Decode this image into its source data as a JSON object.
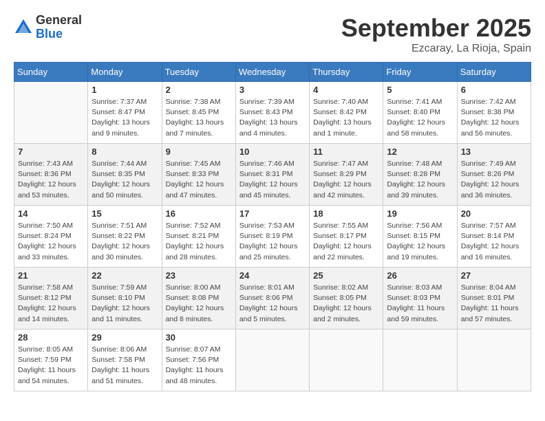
{
  "logo": {
    "general": "General",
    "blue": "Blue"
  },
  "title": "September 2025",
  "location": "Ezcaray, La Rioja, Spain",
  "days_header": [
    "Sunday",
    "Monday",
    "Tuesday",
    "Wednesday",
    "Thursday",
    "Friday",
    "Saturday"
  ],
  "weeks": [
    [
      {
        "num": "",
        "info": ""
      },
      {
        "num": "1",
        "info": "Sunrise: 7:37 AM\nSunset: 8:47 PM\nDaylight: 13 hours\nand 9 minutes."
      },
      {
        "num": "2",
        "info": "Sunrise: 7:38 AM\nSunset: 8:45 PM\nDaylight: 13 hours\nand 7 minutes."
      },
      {
        "num": "3",
        "info": "Sunrise: 7:39 AM\nSunset: 8:43 PM\nDaylight: 13 hours\nand 4 minutes."
      },
      {
        "num": "4",
        "info": "Sunrise: 7:40 AM\nSunset: 8:42 PM\nDaylight: 13 hours\nand 1 minute."
      },
      {
        "num": "5",
        "info": "Sunrise: 7:41 AM\nSunset: 8:40 PM\nDaylight: 12 hours\nand 58 minutes."
      },
      {
        "num": "6",
        "info": "Sunrise: 7:42 AM\nSunset: 8:38 PM\nDaylight: 12 hours\nand 56 minutes."
      }
    ],
    [
      {
        "num": "7",
        "info": "Sunrise: 7:43 AM\nSunset: 8:36 PM\nDaylight: 12 hours\nand 53 minutes."
      },
      {
        "num": "8",
        "info": "Sunrise: 7:44 AM\nSunset: 8:35 PM\nDaylight: 12 hours\nand 50 minutes."
      },
      {
        "num": "9",
        "info": "Sunrise: 7:45 AM\nSunset: 8:33 PM\nDaylight: 12 hours\nand 47 minutes."
      },
      {
        "num": "10",
        "info": "Sunrise: 7:46 AM\nSunset: 8:31 PM\nDaylight: 12 hours\nand 45 minutes."
      },
      {
        "num": "11",
        "info": "Sunrise: 7:47 AM\nSunset: 8:29 PM\nDaylight: 12 hours\nand 42 minutes."
      },
      {
        "num": "12",
        "info": "Sunrise: 7:48 AM\nSunset: 8:28 PM\nDaylight: 12 hours\nand 39 minutes."
      },
      {
        "num": "13",
        "info": "Sunrise: 7:49 AM\nSunset: 8:26 PM\nDaylight: 12 hours\nand 36 minutes."
      }
    ],
    [
      {
        "num": "14",
        "info": "Sunrise: 7:50 AM\nSunset: 8:24 PM\nDaylight: 12 hours\nand 33 minutes."
      },
      {
        "num": "15",
        "info": "Sunrise: 7:51 AM\nSunset: 8:22 PM\nDaylight: 12 hours\nand 30 minutes."
      },
      {
        "num": "16",
        "info": "Sunrise: 7:52 AM\nSunset: 8:21 PM\nDaylight: 12 hours\nand 28 minutes."
      },
      {
        "num": "17",
        "info": "Sunrise: 7:53 AM\nSunset: 8:19 PM\nDaylight: 12 hours\nand 25 minutes."
      },
      {
        "num": "18",
        "info": "Sunrise: 7:55 AM\nSunset: 8:17 PM\nDaylight: 12 hours\nand 22 minutes."
      },
      {
        "num": "19",
        "info": "Sunrise: 7:56 AM\nSunset: 8:15 PM\nDaylight: 12 hours\nand 19 minutes."
      },
      {
        "num": "20",
        "info": "Sunrise: 7:57 AM\nSunset: 8:14 PM\nDaylight: 12 hours\nand 16 minutes."
      }
    ],
    [
      {
        "num": "21",
        "info": "Sunrise: 7:58 AM\nSunset: 8:12 PM\nDaylight: 12 hours\nand 14 minutes."
      },
      {
        "num": "22",
        "info": "Sunrise: 7:59 AM\nSunset: 8:10 PM\nDaylight: 12 hours\nand 11 minutes."
      },
      {
        "num": "23",
        "info": "Sunrise: 8:00 AM\nSunset: 8:08 PM\nDaylight: 12 hours\nand 8 minutes."
      },
      {
        "num": "24",
        "info": "Sunrise: 8:01 AM\nSunset: 8:06 PM\nDaylight: 12 hours\nand 5 minutes."
      },
      {
        "num": "25",
        "info": "Sunrise: 8:02 AM\nSunset: 8:05 PM\nDaylight: 12 hours\nand 2 minutes."
      },
      {
        "num": "26",
        "info": "Sunrise: 8:03 AM\nSunset: 8:03 PM\nDaylight: 11 hours\nand 59 minutes."
      },
      {
        "num": "27",
        "info": "Sunrise: 8:04 AM\nSunset: 8:01 PM\nDaylight: 11 hours\nand 57 minutes."
      }
    ],
    [
      {
        "num": "28",
        "info": "Sunrise: 8:05 AM\nSunset: 7:59 PM\nDaylight: 11 hours\nand 54 minutes."
      },
      {
        "num": "29",
        "info": "Sunrise: 8:06 AM\nSunset: 7:58 PM\nDaylight: 11 hours\nand 51 minutes."
      },
      {
        "num": "30",
        "info": "Sunrise: 8:07 AM\nSunset: 7:56 PM\nDaylight: 11 hours\nand 48 minutes."
      },
      {
        "num": "",
        "info": ""
      },
      {
        "num": "",
        "info": ""
      },
      {
        "num": "",
        "info": ""
      },
      {
        "num": "",
        "info": ""
      }
    ]
  ]
}
